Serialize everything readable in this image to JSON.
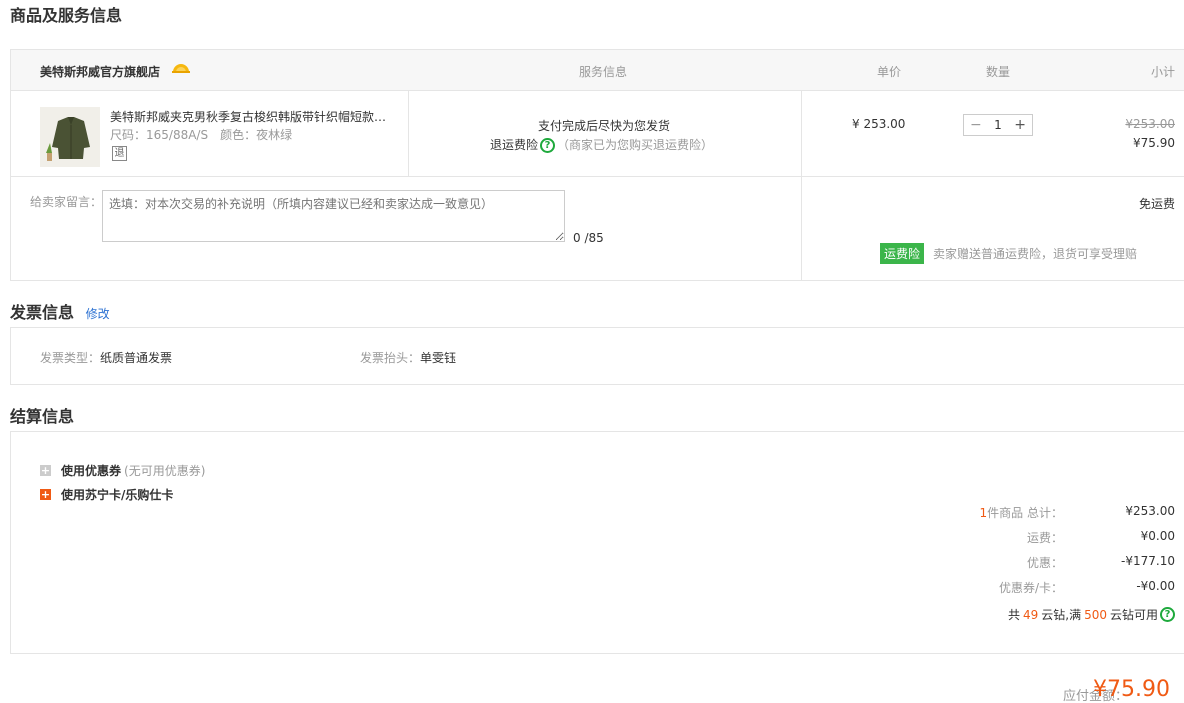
{
  "sections": {
    "goods_title": "商品及服务信息",
    "invoice_title": "发票信息",
    "invoice_edit": "修改",
    "settle_title": "结算信息"
  },
  "goods": {
    "store_name": "美特斯邦威官方旗舰店",
    "headers": {
      "service": "服务信息",
      "price": "单价",
      "qty": "数量",
      "subtotal": "小计"
    },
    "item": {
      "name": "美特斯邦威夹克男秋季复古梭织韩版带针织帽短款…",
      "spec": "尺码：165/88A/S　颜色：夜林绿",
      "return_icon": "退",
      "service_line1": "支付完成后尽快为您发货",
      "service_insurance": "退运费险",
      "service_hint": "（商家已为您购买退运费险）",
      "price": "¥ 253.00",
      "qty_minus": "−",
      "qty": "1",
      "qty_plus": "+",
      "old_subtotal": "¥253.00",
      "subtotal": "¥75.90"
    },
    "message": {
      "label": "给卖家留言：",
      "placeholder": "选填：对本次交易的补充说明（所填内容建议已经和卖家达成一致意见）",
      "count": "0 /85"
    },
    "shipping": "免运费",
    "insurance_badge": "运费险",
    "insurance_text": "卖家赠送普通运费险，退货可享受理赔"
  },
  "invoice": {
    "type_label": "发票类型：",
    "type_value": "纸质普通发票",
    "title_label": "发票抬头：",
    "title_value": "单雯钰"
  },
  "settle": {
    "coupon_label": "使用优惠券",
    "coupon_note": "(无可用优惠券)",
    "card_label": "使用苏宁卡/乐购仕卡",
    "count_num": "1",
    "total_label": "件商品 总计：",
    "total_value": "¥253.00",
    "shipping_label": "运费：",
    "shipping_value": "¥0.00",
    "discount_label": "优惠：",
    "discount_value": "-¥177.10",
    "coupon_card_label": "优惠券/卡：",
    "coupon_card_value": "-¥0.00",
    "coins_prefix": "共",
    "coins_num": "49",
    "coins_mid": "云钻,满",
    "coins_limit": "500",
    "coins_suffix": "云钻可用"
  },
  "payable": {
    "label": "应付金额：",
    "value": "¥75.90"
  },
  "colors": {
    "accent": "#f05a14",
    "green": "#1ea93c",
    "link": "#2d72d2"
  }
}
